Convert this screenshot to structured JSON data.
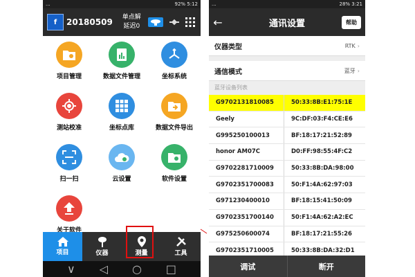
{
  "left_phone": {
    "status": {
      "left": "...",
      "right": "92% 5:12"
    },
    "header": {
      "project_icon": "f",
      "project_name": "20180509",
      "solution_status": "单点解",
      "latency": "延迟0",
      "icons": [
        "receiver-icon",
        "satellite-icon",
        "grid-menu-icon"
      ]
    },
    "grid": [
      {
        "label": "项目管理",
        "icon": "folder-settings-icon",
        "color": "#f5a623"
      },
      {
        "label": "数据文件管理",
        "icon": "data-file-icon",
        "color": "#37b26a"
      },
      {
        "label": "坐标系统",
        "icon": "coordinate-axes-icon",
        "color": "#2f8ee0"
      },
      {
        "label": "测站校准",
        "icon": "crosshair-target-icon",
        "color": "#e8453c"
      },
      {
        "label": "坐标点库",
        "icon": "point-grid-icon",
        "color": "#2f8ee0"
      },
      {
        "label": "数据文件导出",
        "icon": "folder-export-icon",
        "color": "#f5a623"
      },
      {
        "label": "扫一扫",
        "icon": "qr-scan-icon",
        "color": "#2f8ee0"
      },
      {
        "label": "云设置",
        "icon": "cloud-settings-icon",
        "color": "#6ab6f0"
      },
      {
        "label": "软件设置",
        "icon": "software-settings-icon",
        "color": "#37b26a"
      },
      {
        "label": "关于软件",
        "icon": "upload-arrow-icon",
        "color": "#e8453c"
      }
    ],
    "bottom_nav": [
      {
        "label": "项目",
        "icon": "home-icon"
      },
      {
        "label": "仪器",
        "icon": "instrument-icon"
      },
      {
        "label": "测量",
        "icon": "map-pin-icon"
      },
      {
        "label": "工具",
        "icon": "tools-icon"
      }
    ],
    "system_nav": {
      "down": "∨",
      "back": "◁",
      "home": "○",
      "recent": "□"
    }
  },
  "right_phone": {
    "status": {
      "left": "...",
      "right": "28% 3:21"
    },
    "title": "通讯设置",
    "help_label": "帮助",
    "rows": [
      {
        "label": "仪器类型",
        "value": "RTK"
      },
      {
        "label": "通信模式",
        "value": "蓝牙"
      }
    ],
    "section_label": "蓝牙设备列表",
    "devices": [
      {
        "name": "G9702131810085",
        "mac": "50:33:8B:E1:75:1E",
        "selected": true
      },
      {
        "name": "Geely",
        "mac": "9C:DF:03:F4:CE:E6",
        "selected": false
      },
      {
        "name": "G995250100013",
        "mac": "BF:18:17:21:52:89",
        "selected": false
      },
      {
        "name": "honor AM07C",
        "mac": "D0:FF:98:55:4F:C2",
        "selected": false
      },
      {
        "name": "G9702281710009",
        "mac": "50:33:8B:DA:98:00",
        "selected": false
      },
      {
        "name": "G9702351700083",
        "mac": "50:F1:4A:62:97:03",
        "selected": false
      },
      {
        "name": "G971230400010",
        "mac": "BF:18:15:41:50:09",
        "selected": false
      },
      {
        "name": "G9702351700140",
        "mac": "50:F1:4A:62:A2:EC",
        "selected": false
      },
      {
        "name": "G975250600074",
        "mac": "BF:18:17:21:55:26",
        "selected": false
      },
      {
        "name": "G9702351710005",
        "mac": "50:33:8B:DA:32:D1",
        "selected": false
      }
    ],
    "bottom": {
      "debug": "调试",
      "disconnect": "断开"
    }
  },
  "colors": {
    "accent": "#1e8fe8",
    "highlight": "#ffff00",
    "callout": "#e01010"
  }
}
